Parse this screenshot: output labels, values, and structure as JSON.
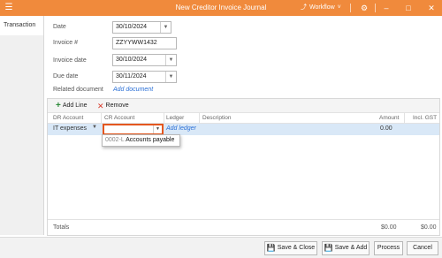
{
  "window": {
    "title": "New Creditor Invoice Journal",
    "app_icon": "app-menu-icon",
    "workflow_label": "Workflow",
    "accent_color": "#f08a3c"
  },
  "tabs": {
    "transaction": "Transaction"
  },
  "form": {
    "date_label": "Date",
    "date_value": "30/10/2024",
    "invoice_no_label": "Invoice #",
    "invoice_no_value": "ZZYYWW1432",
    "invoice_date_label": "Invoice date",
    "invoice_date_value": "30/10/2024",
    "due_date_label": "Due date",
    "due_date_value": "30/11/2024",
    "related_document_label": "Related document",
    "add_document_link": "Add document"
  },
  "grid": {
    "toolbar": {
      "add_line": "Add Line",
      "remove": "Remove"
    },
    "columns": {
      "dr_account": "DR Account",
      "cr_account": "CR Account",
      "ledger": "Ledger",
      "description": "Description",
      "amount": "Amount",
      "incl_gst": "Incl. GST"
    },
    "row": {
      "dr_account": "IT expenses",
      "cr_account": "",
      "ledger_link": "Add ledger",
      "description": "",
      "amount": "0.00",
      "incl_gst": ""
    },
    "dropdown_option": {
      "code": "0002-L",
      "name": "Accounts payable"
    },
    "totals": {
      "label": "Totals",
      "amount": "$0.00",
      "incl_gst": "$0.00"
    }
  },
  "buttons": {
    "save_close": "Save & Close",
    "save_add": "Save & Add",
    "process": "Process",
    "cancel": "Cancel"
  }
}
